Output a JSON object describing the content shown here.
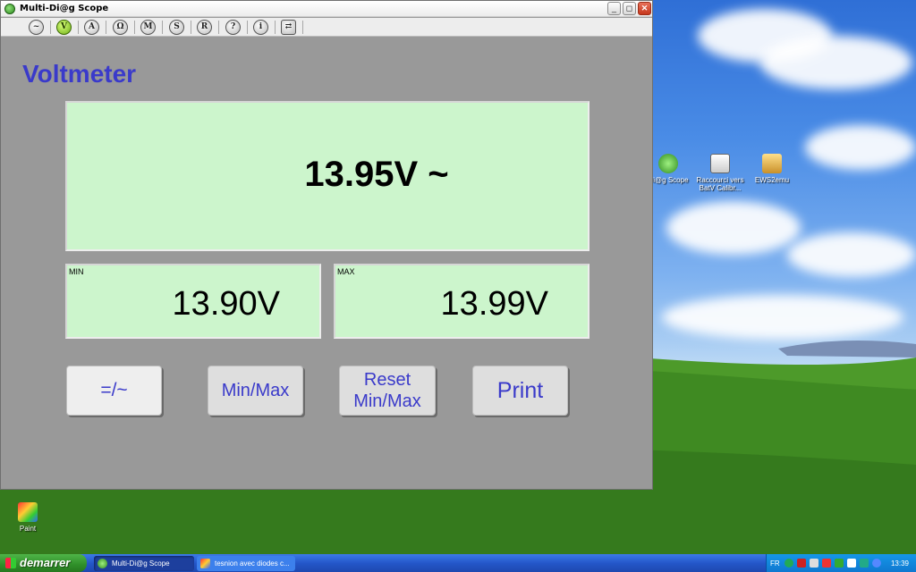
{
  "window": {
    "title": "Multi-Di@g Scope",
    "controls": {
      "minimize": "_",
      "maximize": "◻",
      "close": "✕"
    }
  },
  "toolbar": {
    "buttons": [
      {
        "name": "waveform",
        "glyph": "~",
        "active": false
      },
      {
        "name": "voltmeter",
        "glyph": "V",
        "active": true
      },
      {
        "name": "ammeter",
        "glyph": "A",
        "active": false
      },
      {
        "name": "ohmmeter",
        "glyph": "Ω",
        "active": false
      },
      {
        "name": "m-mode",
        "glyph": "M",
        "active": false
      },
      {
        "name": "s-mode",
        "glyph": "S",
        "active": false
      },
      {
        "name": "r-mode",
        "glyph": "R",
        "active": false
      },
      {
        "name": "help",
        "glyph": "?",
        "active": false
      },
      {
        "name": "info",
        "glyph": "i",
        "active": false
      },
      {
        "name": "exit",
        "glyph": "⇄",
        "active": false
      }
    ]
  },
  "app": {
    "title": "Voltmeter",
    "reading": "13.95V ~",
    "min_label": "MIN",
    "min_value": "13.90V",
    "max_label": "MAX",
    "max_value": "13.99V"
  },
  "buttons": {
    "mode": "=/~",
    "minmax": "Min/Max",
    "reset_line1": "Reset",
    "reset_line2": "Min/Max",
    "print": "Print"
  },
  "desktop_icons": [
    {
      "label_line1": "Di@g Scope",
      "label_line2": ""
    },
    {
      "label_line1": "Raccourci vers",
      "label_line2": "BatV Calibr..."
    },
    {
      "label_line1": "EWS2emu",
      "label_line2": ""
    },
    {
      "label_line1": "Paint",
      "label_line2": ""
    }
  ],
  "taskbar": {
    "start_label": "demarrer",
    "tasks": [
      {
        "label": "Multi-Di@g Scope",
        "active": true
      },
      {
        "label": "tesnion avec diodes c...",
        "active": false
      }
    ],
    "language": "FR",
    "clock": "13:39"
  },
  "colors": {
    "accent_text": "#3a3aca",
    "panel_bg": "#ccf5cc",
    "window_bg": "#999999",
    "active_tool": "#6fae18"
  }
}
